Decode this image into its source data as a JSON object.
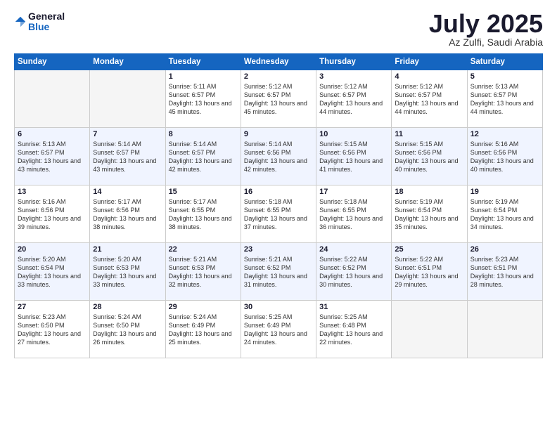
{
  "header": {
    "logo_general": "General",
    "logo_blue": "Blue",
    "month_title": "July 2025",
    "location": "Az Zulfi, Saudi Arabia"
  },
  "weekdays": [
    "Sunday",
    "Monday",
    "Tuesday",
    "Wednesday",
    "Thursday",
    "Friday",
    "Saturday"
  ],
  "weeks": [
    [
      {
        "day": "",
        "sunrise": "",
        "sunset": "",
        "daylight": ""
      },
      {
        "day": "",
        "sunrise": "",
        "sunset": "",
        "daylight": ""
      },
      {
        "day": "1",
        "sunrise": "Sunrise: 5:11 AM",
        "sunset": "Sunset: 6:57 PM",
        "daylight": "Daylight: 13 hours and 45 minutes."
      },
      {
        "day": "2",
        "sunrise": "Sunrise: 5:12 AM",
        "sunset": "Sunset: 6:57 PM",
        "daylight": "Daylight: 13 hours and 45 minutes."
      },
      {
        "day": "3",
        "sunrise": "Sunrise: 5:12 AM",
        "sunset": "Sunset: 6:57 PM",
        "daylight": "Daylight: 13 hours and 44 minutes."
      },
      {
        "day": "4",
        "sunrise": "Sunrise: 5:12 AM",
        "sunset": "Sunset: 6:57 PM",
        "daylight": "Daylight: 13 hours and 44 minutes."
      },
      {
        "day": "5",
        "sunrise": "Sunrise: 5:13 AM",
        "sunset": "Sunset: 6:57 PM",
        "daylight": "Daylight: 13 hours and 44 minutes."
      }
    ],
    [
      {
        "day": "6",
        "sunrise": "Sunrise: 5:13 AM",
        "sunset": "Sunset: 6:57 PM",
        "daylight": "Daylight: 13 hours and 43 minutes."
      },
      {
        "day": "7",
        "sunrise": "Sunrise: 5:14 AM",
        "sunset": "Sunset: 6:57 PM",
        "daylight": "Daylight: 13 hours and 43 minutes."
      },
      {
        "day": "8",
        "sunrise": "Sunrise: 5:14 AM",
        "sunset": "Sunset: 6:57 PM",
        "daylight": "Daylight: 13 hours and 42 minutes."
      },
      {
        "day": "9",
        "sunrise": "Sunrise: 5:14 AM",
        "sunset": "Sunset: 6:56 PM",
        "daylight": "Daylight: 13 hours and 42 minutes."
      },
      {
        "day": "10",
        "sunrise": "Sunrise: 5:15 AM",
        "sunset": "Sunset: 6:56 PM",
        "daylight": "Daylight: 13 hours and 41 minutes."
      },
      {
        "day": "11",
        "sunrise": "Sunrise: 5:15 AM",
        "sunset": "Sunset: 6:56 PM",
        "daylight": "Daylight: 13 hours and 40 minutes."
      },
      {
        "day": "12",
        "sunrise": "Sunrise: 5:16 AM",
        "sunset": "Sunset: 6:56 PM",
        "daylight": "Daylight: 13 hours and 40 minutes."
      }
    ],
    [
      {
        "day": "13",
        "sunrise": "Sunrise: 5:16 AM",
        "sunset": "Sunset: 6:56 PM",
        "daylight": "Daylight: 13 hours and 39 minutes."
      },
      {
        "day": "14",
        "sunrise": "Sunrise: 5:17 AM",
        "sunset": "Sunset: 6:56 PM",
        "daylight": "Daylight: 13 hours and 38 minutes."
      },
      {
        "day": "15",
        "sunrise": "Sunrise: 5:17 AM",
        "sunset": "Sunset: 6:55 PM",
        "daylight": "Daylight: 13 hours and 38 minutes."
      },
      {
        "day": "16",
        "sunrise": "Sunrise: 5:18 AM",
        "sunset": "Sunset: 6:55 PM",
        "daylight": "Daylight: 13 hours and 37 minutes."
      },
      {
        "day": "17",
        "sunrise": "Sunrise: 5:18 AM",
        "sunset": "Sunset: 6:55 PM",
        "daylight": "Daylight: 13 hours and 36 minutes."
      },
      {
        "day": "18",
        "sunrise": "Sunrise: 5:19 AM",
        "sunset": "Sunset: 6:54 PM",
        "daylight": "Daylight: 13 hours and 35 minutes."
      },
      {
        "day": "19",
        "sunrise": "Sunrise: 5:19 AM",
        "sunset": "Sunset: 6:54 PM",
        "daylight": "Daylight: 13 hours and 34 minutes."
      }
    ],
    [
      {
        "day": "20",
        "sunrise": "Sunrise: 5:20 AM",
        "sunset": "Sunset: 6:54 PM",
        "daylight": "Daylight: 13 hours and 33 minutes."
      },
      {
        "day": "21",
        "sunrise": "Sunrise: 5:20 AM",
        "sunset": "Sunset: 6:53 PM",
        "daylight": "Daylight: 13 hours and 33 minutes."
      },
      {
        "day": "22",
        "sunrise": "Sunrise: 5:21 AM",
        "sunset": "Sunset: 6:53 PM",
        "daylight": "Daylight: 13 hours and 32 minutes."
      },
      {
        "day": "23",
        "sunrise": "Sunrise: 5:21 AM",
        "sunset": "Sunset: 6:52 PM",
        "daylight": "Daylight: 13 hours and 31 minutes."
      },
      {
        "day": "24",
        "sunrise": "Sunrise: 5:22 AM",
        "sunset": "Sunset: 6:52 PM",
        "daylight": "Daylight: 13 hours and 30 minutes."
      },
      {
        "day": "25",
        "sunrise": "Sunrise: 5:22 AM",
        "sunset": "Sunset: 6:51 PM",
        "daylight": "Daylight: 13 hours and 29 minutes."
      },
      {
        "day": "26",
        "sunrise": "Sunrise: 5:23 AM",
        "sunset": "Sunset: 6:51 PM",
        "daylight": "Daylight: 13 hours and 28 minutes."
      }
    ],
    [
      {
        "day": "27",
        "sunrise": "Sunrise: 5:23 AM",
        "sunset": "Sunset: 6:50 PM",
        "daylight": "Daylight: 13 hours and 27 minutes."
      },
      {
        "day": "28",
        "sunrise": "Sunrise: 5:24 AM",
        "sunset": "Sunset: 6:50 PM",
        "daylight": "Daylight: 13 hours and 26 minutes."
      },
      {
        "day": "29",
        "sunrise": "Sunrise: 5:24 AM",
        "sunset": "Sunset: 6:49 PM",
        "daylight": "Daylight: 13 hours and 25 minutes."
      },
      {
        "day": "30",
        "sunrise": "Sunrise: 5:25 AM",
        "sunset": "Sunset: 6:49 PM",
        "daylight": "Daylight: 13 hours and 24 minutes."
      },
      {
        "day": "31",
        "sunrise": "Sunrise: 5:25 AM",
        "sunset": "Sunset: 6:48 PM",
        "daylight": "Daylight: 13 hours and 22 minutes."
      },
      {
        "day": "",
        "sunrise": "",
        "sunset": "",
        "daylight": ""
      },
      {
        "day": "",
        "sunrise": "",
        "sunset": "",
        "daylight": ""
      }
    ]
  ]
}
